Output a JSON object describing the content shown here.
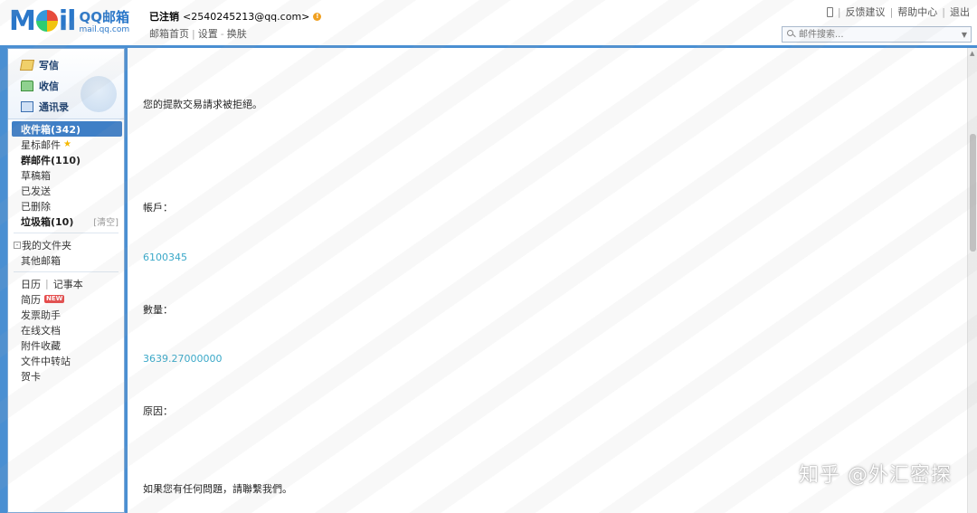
{
  "header": {
    "logo_text": "MOil",
    "logo_brand": "QQ邮箱",
    "logo_domain": "mail.qq.com",
    "account_prefix": "已注销",
    "account_email": "<2540245213@qq.com>",
    "links": [
      "邮箱首页",
      "设置",
      "换肤"
    ],
    "top_links": [
      "反馈建议",
      "帮助中心",
      "退出"
    ],
    "search_placeholder": "邮件搜索..."
  },
  "sidebar": {
    "actions": [
      {
        "label": "写信",
        "icon": "pencil-icon"
      },
      {
        "label": "收信",
        "icon": "inbox-icon"
      },
      {
        "label": "通讯录",
        "icon": "contacts-icon"
      }
    ],
    "folders": {
      "inbox": "收件箱(342)",
      "starred": "星标邮件",
      "group": "群邮件(110)",
      "drafts": "草稿箱",
      "sent": "已发送",
      "deleted": "已删除",
      "spam": "垃圾箱(10)",
      "spam_clear": "[清空]",
      "my_folders": "我的文件夹",
      "other_mailboxes": "其他邮箱"
    },
    "apps": {
      "calendar": "日历",
      "notes": "记事本",
      "resume": "简历",
      "resume_badge": "NEW",
      "feed": "发票助手",
      "docs": "在线文档",
      "attachments": "附件收藏",
      "transfer": "文件中转站",
      "cards": "贺卡"
    }
  },
  "email": {
    "line1": "您的提款交易請求被拒絕。",
    "account_label": "帳戶：",
    "account_value": "6100345",
    "amount_label": "數量：",
    "amount_value": "3639.27000000",
    "reason_label": "原因：",
    "footer": "如果您有任何問題，請聯繫我們。"
  },
  "watermark": "知乎 @外汇密探",
  "colors": {
    "frame_blue": "#4a8fd2",
    "active_folder": "#3f7fc6",
    "value_cyan": "#3aa8c8"
  }
}
